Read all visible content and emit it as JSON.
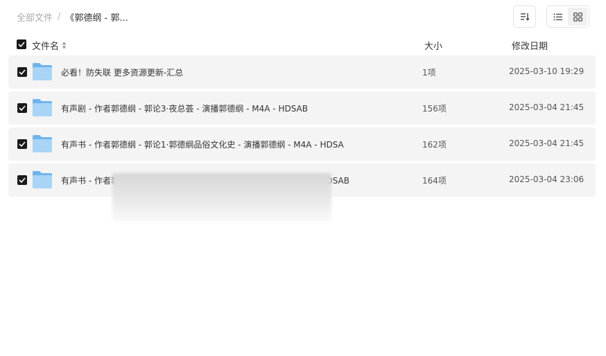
{
  "breadcrumb": {
    "root": "全部文件",
    "separator": "/",
    "current": "《郭德纲 - 郭..."
  },
  "toolbar": {
    "sort_icon": "sort-icon",
    "list_view_icon": "list-view-icon",
    "grid_view_icon": "grid-view-icon"
  },
  "table": {
    "headers": {
      "name": "文件名",
      "size": "大小",
      "date": "修改日期"
    },
    "rows": [
      {
        "name": "必看！防失联 更多资源更新-汇总",
        "size": "1项",
        "date": "2025-03-10 19:29"
      },
      {
        "name": "有声剧 - 作者郭德纲 - 郭论3·夜总荟 - 演播郭德纲 - M4A - HDSAB",
        "size": "156项",
        "date": "2025-03-04 21:45"
      },
      {
        "name": "有声书 - 作者郭德纲 - 郭论1·郭德纲品俗文化史 - 演播郭德纲 - M4A - HDSA",
        "size": "162项",
        "date": "2025-03-04 21:45"
      },
      {
        "name": "有声书 - 作者郭德纲 - 郭论2·郭德纲品俗文化史 - 演播郭德纲 - M4A - HDSAB",
        "size": "164项",
        "date": "2025-03-04 23:06"
      }
    ]
  },
  "colors": {
    "row_bg": "#f4f4f4",
    "checkbox": "#1a1a1a",
    "folder_light": "#a9d4f7",
    "folder_dark": "#6fb3ec"
  }
}
